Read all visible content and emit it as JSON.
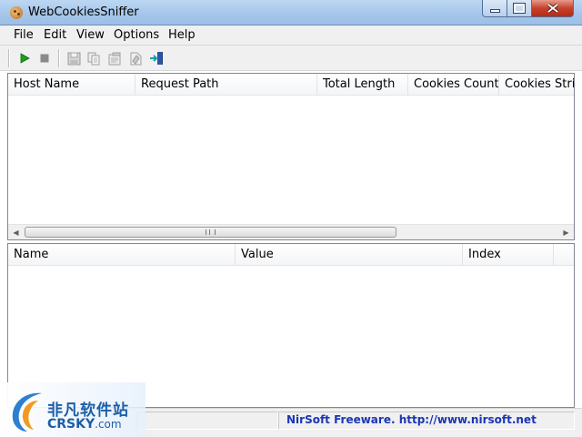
{
  "window": {
    "title": "WebCookiesSniffer"
  },
  "menu": [
    "File",
    "Edit",
    "View",
    "Options",
    "Help"
  ],
  "toolbar": {
    "buttons": [
      {
        "icon": "play-icon",
        "color": "#1aa01a",
        "enabled": true
      },
      {
        "icon": "stop-icon",
        "color": "#7a7a7a",
        "enabled": false
      },
      {
        "icon": "save-icon",
        "enabled": false
      },
      {
        "icon": "copy-icon",
        "enabled": false
      },
      {
        "icon": "properties-icon",
        "enabled": false
      },
      {
        "icon": "html-report-icon",
        "enabled": false
      },
      {
        "icon": "exit-icon",
        "color": "#1aa0a0",
        "enabled": true
      }
    ]
  },
  "top_table": {
    "columns": [
      "Host Name",
      "Request Path",
      "Total Length",
      "Cookies Count",
      "Cookies String"
    ],
    "rows": []
  },
  "bottom_table": {
    "columns": [
      "Name",
      "Value",
      "Index"
    ],
    "rows": []
  },
  "status": {
    "text": "NirSoft Freeware.  http://www.nirsoft.net"
  },
  "watermark": {
    "cn": "非凡软件站",
    "en": "CRSKY",
    "en_suffix": ".com"
  },
  "colors": {
    "status_link": "#1a36b5",
    "watermark": "#1b5fa8"
  }
}
